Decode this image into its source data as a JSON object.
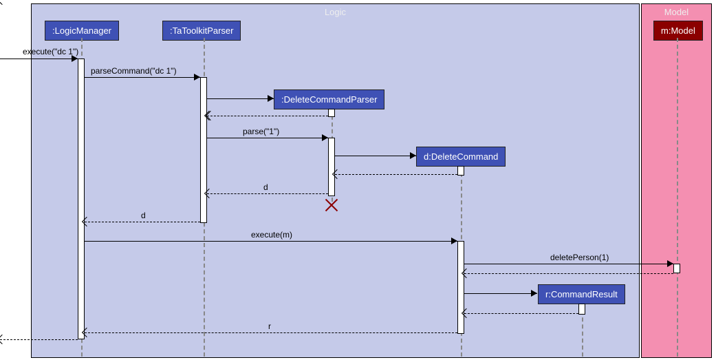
{
  "frames": {
    "logic": "Logic",
    "model": "Model"
  },
  "participants": {
    "logicManager": ":LogicManager",
    "taToolkitParser": ":TaToolkitParser",
    "deleteCommandParser": ":DeleteCommandParser",
    "deleteCommand": "d:DeleteCommand",
    "commandResult": "r:CommandResult",
    "model": "m:Model"
  },
  "messages": {
    "execute1": "execute(\"dc 1\")",
    "parseCommand": "parseCommand(\"dc 1\")",
    "parse": "parse(\"1\")",
    "returnD1": "d",
    "returnD2": "d",
    "executeM": "execute(m)",
    "deletePerson": "deletePerson(1)",
    "returnR": "r"
  }
}
